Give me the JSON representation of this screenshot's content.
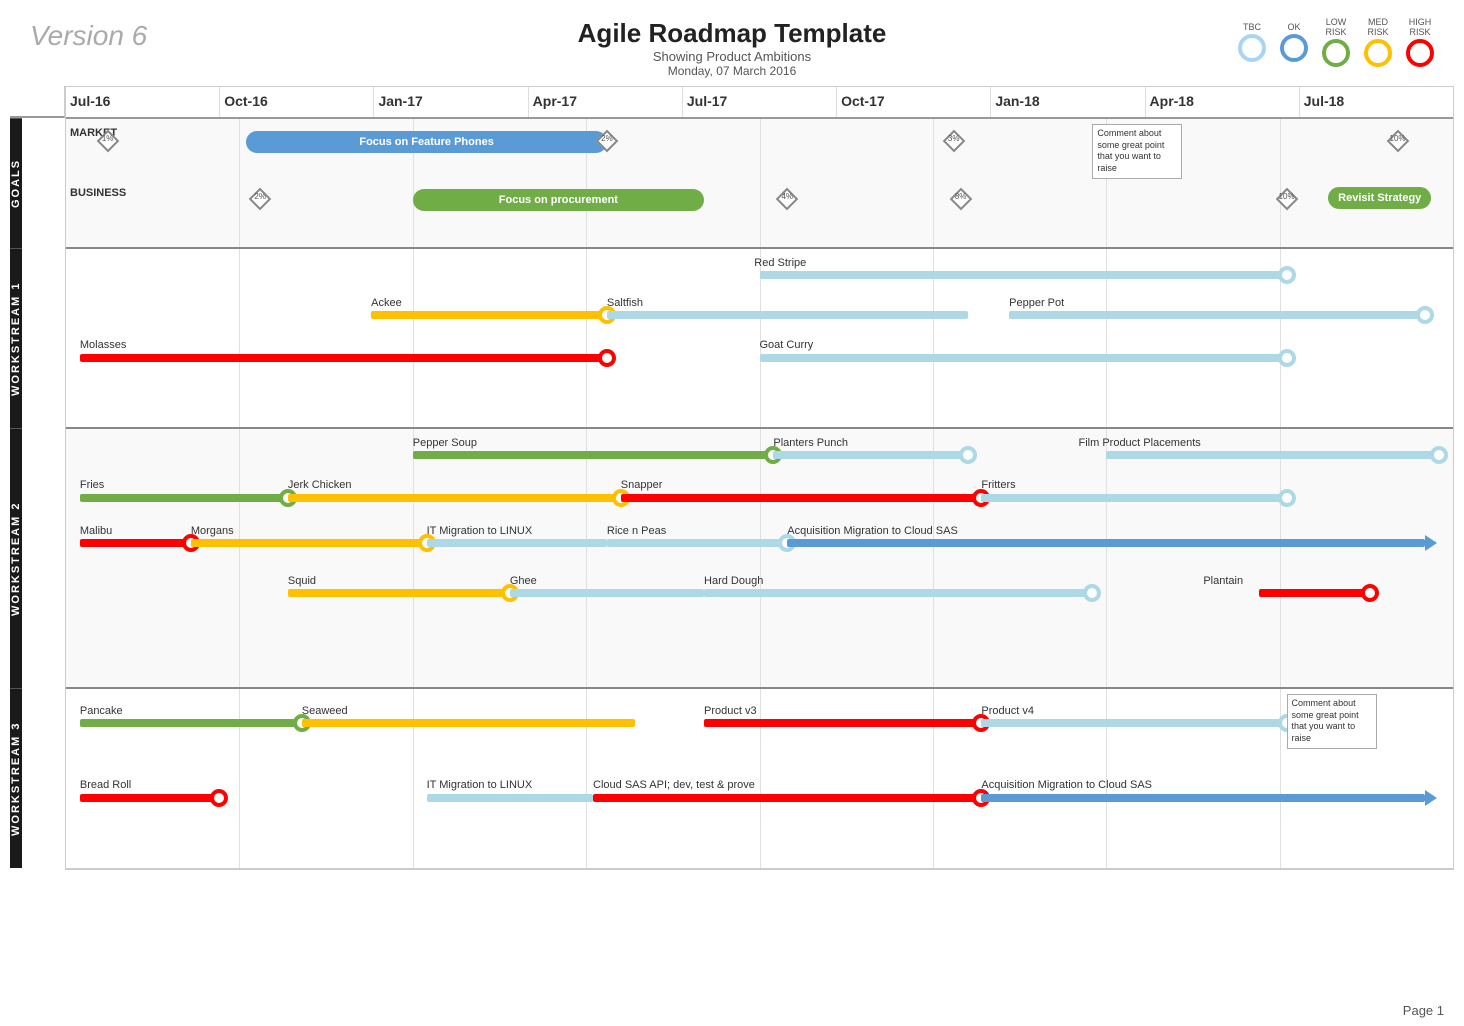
{
  "header": {
    "version": "Version 6",
    "title": "Agile Roadmap Template",
    "subtitle": "Showing Product Ambitions",
    "date": "Monday, 07 March 2016"
  },
  "legend": {
    "items": [
      {
        "label": "TBC",
        "class": "tbc"
      },
      {
        "label": "OK",
        "class": "ok"
      },
      {
        "label": "LOW\nRISK",
        "class": "low"
      },
      {
        "label": "MED\nRISK",
        "class": "med"
      },
      {
        "label": "HIGH\nRISK",
        "class": "high"
      }
    ]
  },
  "timeline": {
    "cols": [
      "Jul-16",
      "Oct-16",
      "Jan-17",
      "Apr-17",
      "Jul-17",
      "Oct-17",
      "Jan-18",
      "Apr-18",
      "Jul-18"
    ]
  },
  "sections": [
    {
      "label": "GOALS",
      "rows": [
        {
          "type": "goals"
        }
      ]
    },
    {
      "label": "WORKSTREAM 1",
      "rows": [
        {
          "type": "ws1"
        }
      ]
    },
    {
      "label": "WORKSTREAM 2",
      "rows": [
        {
          "type": "ws2"
        }
      ]
    },
    {
      "label": "WORKSTREAM 3",
      "rows": [
        {
          "type": "ws3"
        }
      ]
    }
  ],
  "page": "Page 1"
}
